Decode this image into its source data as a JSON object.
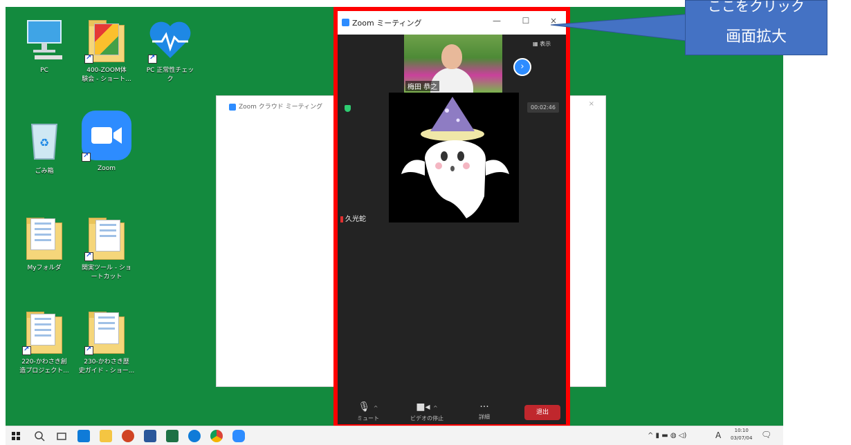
{
  "desktop_icons": [
    {
      "id": "pc",
      "label": "PC",
      "icon": "monitor-icon"
    },
    {
      "id": "zoom-session",
      "label": "400-ZOOM体\n験会 - ショート...",
      "icon": "folder-shortcut-icon"
    },
    {
      "id": "health-check",
      "label": "PC 正常性チェッ\nク",
      "icon": "heartbeat-icon"
    },
    {
      "id": "recycle",
      "label": "ごみ箱",
      "icon": "recycle-bin-icon"
    },
    {
      "id": "zoom-app",
      "label": "Zoom",
      "icon": "zoom-camera-icon"
    },
    {
      "id": "my-folder",
      "label": "Myフォルダ",
      "icon": "folder-icon"
    },
    {
      "id": "tools",
      "label": "関実ツール - ショ\nートカット",
      "icon": "folder-shortcut-icon"
    },
    {
      "id": "kawasaki-project",
      "label": "220-かわさき創\n造プロジェクト...",
      "icon": "folder-shortcut-icon"
    },
    {
      "id": "kawasaki-guide",
      "label": "230-かわさき歴\n史ガイド - ショー...",
      "icon": "folder-shortcut-icon"
    }
  ],
  "cloud_window": {
    "title": "Zoom クラウド ミーティング",
    "close": "×"
  },
  "zoom_window": {
    "title": "Zoom ミーティング",
    "minimize": "—",
    "maximize": "☐",
    "close": "×",
    "view_label": "表示",
    "timer": "00:02:46",
    "participant_top": "梅田 恭之",
    "participant_main": "久光蛇",
    "toolbar": {
      "mute": "ミュート",
      "video": "ビデオの停止",
      "more": "詳細",
      "more_glyph": "···",
      "leave": "退出"
    }
  },
  "callout": {
    "line1": "ここをクリック",
    "line2": "画面拡大"
  },
  "taskbar": {
    "clock_time": "10:10",
    "clock_date": "03/07/04",
    "ime": "A",
    "colors": {
      "edge": "#0f7bd8",
      "excel": "#1e7145",
      "chrome": "#db4437",
      "zoom": "#2d8cff"
    }
  }
}
